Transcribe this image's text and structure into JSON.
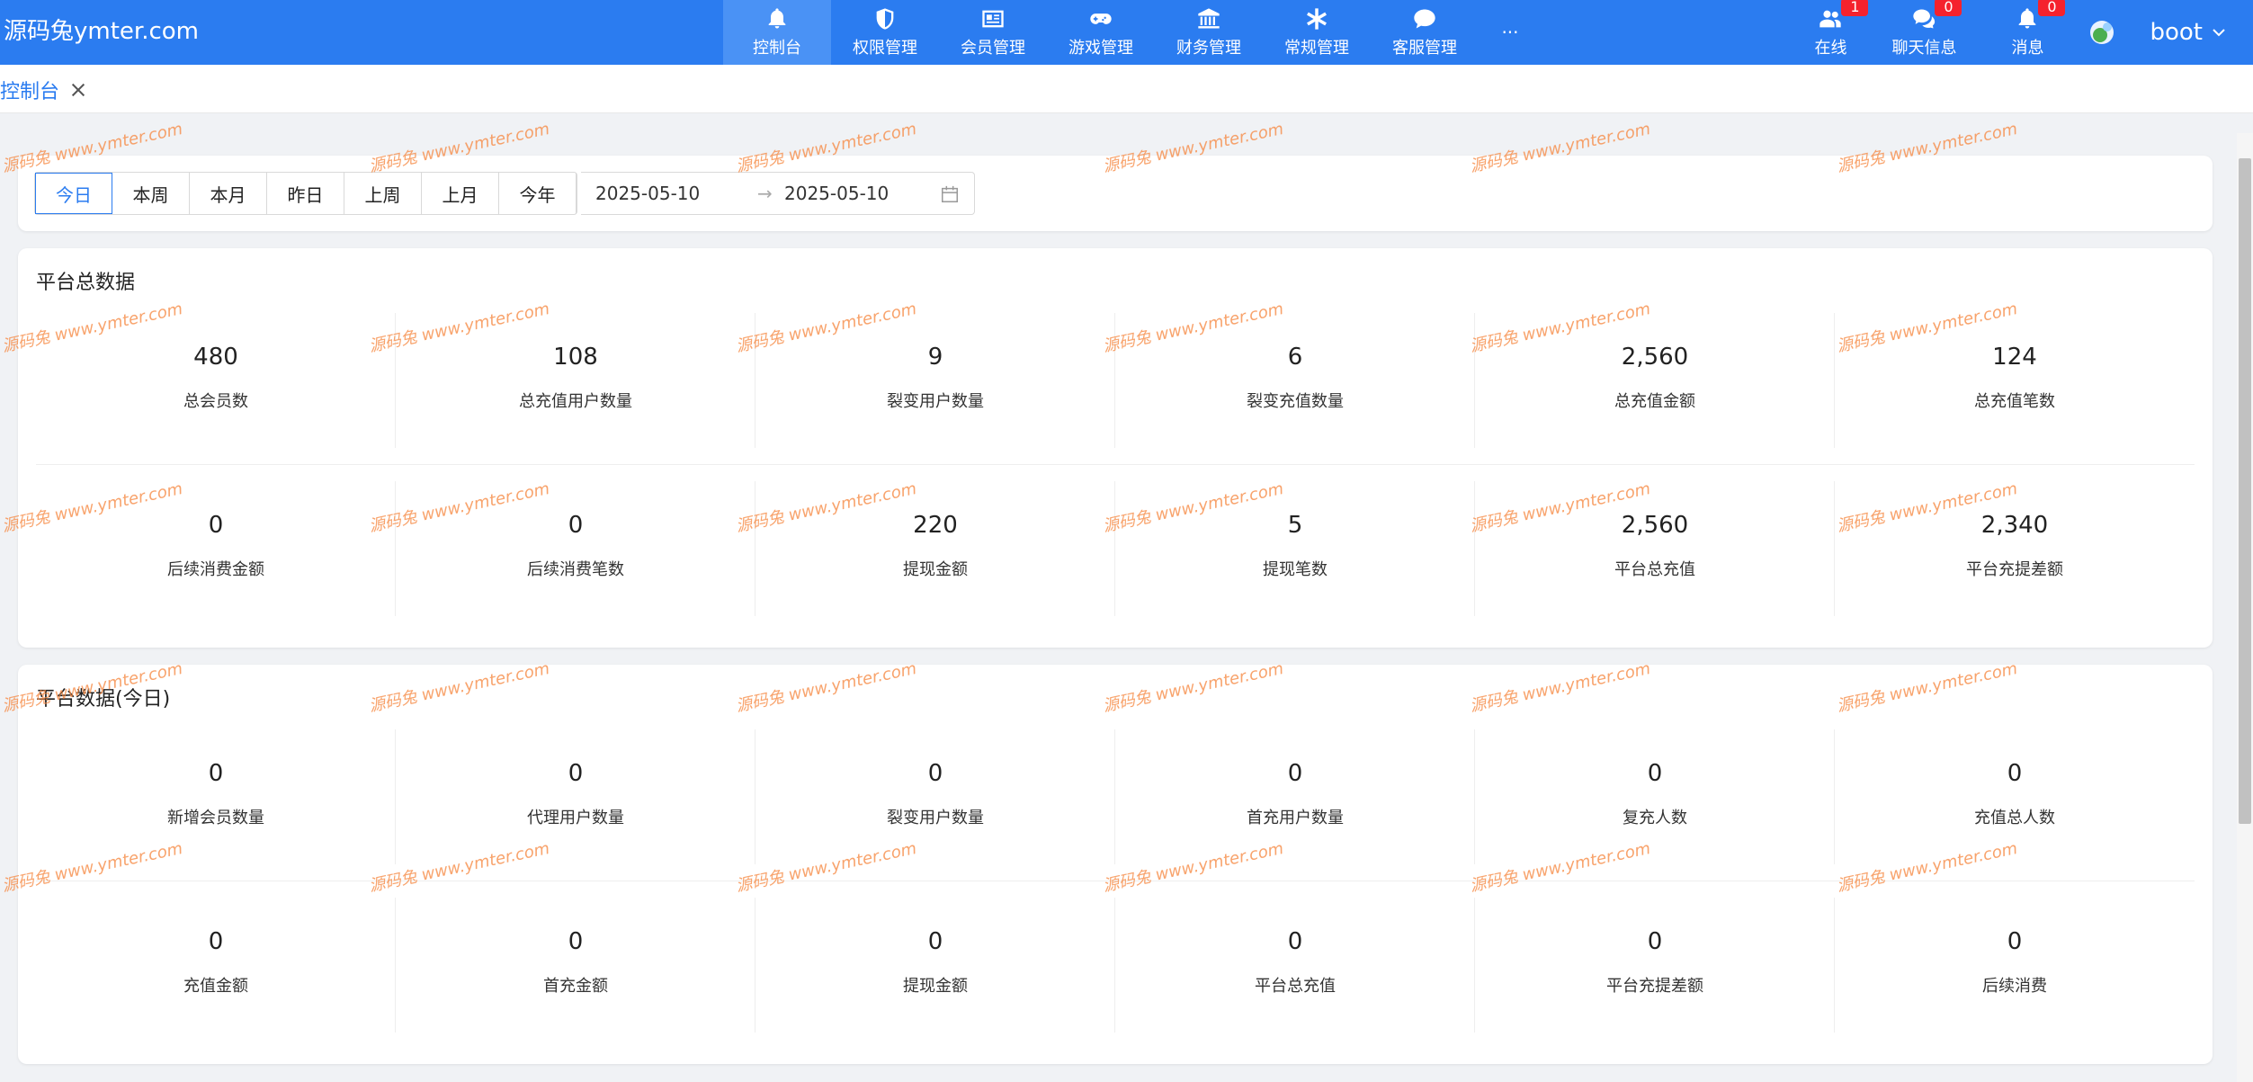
{
  "header": {
    "logo": "源码兔ymter.com",
    "nav": [
      {
        "label": "控制台",
        "icon": "bell-icon",
        "active": true
      },
      {
        "label": "权限管理",
        "icon": "shield-icon",
        "active": false
      },
      {
        "label": "会员管理",
        "icon": "id-card-icon",
        "active": false
      },
      {
        "label": "游戏管理",
        "icon": "gamepad-icon",
        "active": false
      },
      {
        "label": "财务管理",
        "icon": "bank-icon",
        "active": false
      },
      {
        "label": "常规管理",
        "icon": "asterisk-icon",
        "active": false
      },
      {
        "label": "客服管理",
        "icon": "chat-icon",
        "active": false
      }
    ],
    "more": "···",
    "tools": {
      "online": {
        "label": "在线",
        "badge": "1",
        "icon": "users-icon"
      },
      "chat": {
        "label": "聊天信息",
        "badge": "0",
        "icon": "chat-bubbles-icon"
      },
      "messages": {
        "label": "消息",
        "badge": "0",
        "icon": "bell-icon"
      }
    },
    "user": {
      "name": "boot",
      "icon": "chevron-down-icon"
    }
  },
  "tabs": [
    {
      "label": "控制台"
    }
  ],
  "date_filter": {
    "buttons": [
      "今日",
      "本周",
      "本月",
      "昨日",
      "上周",
      "上月",
      "今年"
    ],
    "active": "今日",
    "start": "2025-05-10",
    "end": "2025-05-10",
    "arrow": "→"
  },
  "platform_total": {
    "title": "平台总数据",
    "row1": [
      {
        "value": "480",
        "label": "总会员数"
      },
      {
        "value": "108",
        "label": "总充值用户数量"
      },
      {
        "value": "9",
        "label": "裂变用户数量"
      },
      {
        "value": "6",
        "label": "裂变充值数量"
      },
      {
        "value": "2,560",
        "label": "总充值金额"
      },
      {
        "value": "124",
        "label": "总充值笔数"
      }
    ],
    "row2": [
      {
        "value": "0",
        "label": "后续消费金额"
      },
      {
        "value": "0",
        "label": "后续消费笔数"
      },
      {
        "value": "220",
        "label": "提现金额"
      },
      {
        "value": "5",
        "label": "提现笔数"
      },
      {
        "value": "2,560",
        "label": "平台总充值"
      },
      {
        "value": "2,340",
        "label": "平台充提差额"
      }
    ]
  },
  "platform_today": {
    "title": "平台数据(今日)",
    "row1": [
      {
        "value": "0",
        "label": "新增会员数量"
      },
      {
        "value": "0",
        "label": "代理用户数量"
      },
      {
        "value": "0",
        "label": "裂变用户数量"
      },
      {
        "value": "0",
        "label": "首充用户数量"
      },
      {
        "value": "0",
        "label": "复充人数"
      },
      {
        "value": "0",
        "label": "充值总人数"
      }
    ],
    "row2": [
      {
        "value": "0",
        "label": "充值金额"
      },
      {
        "value": "0",
        "label": "首充金额"
      },
      {
        "value": "0",
        "label": "提现金额"
      },
      {
        "value": "0",
        "label": "平台总充值"
      },
      {
        "value": "0",
        "label": "平台充提差额"
      },
      {
        "value": "0",
        "label": "后续消费"
      }
    ]
  },
  "watermark": "源码兔 www.ymter.com"
}
